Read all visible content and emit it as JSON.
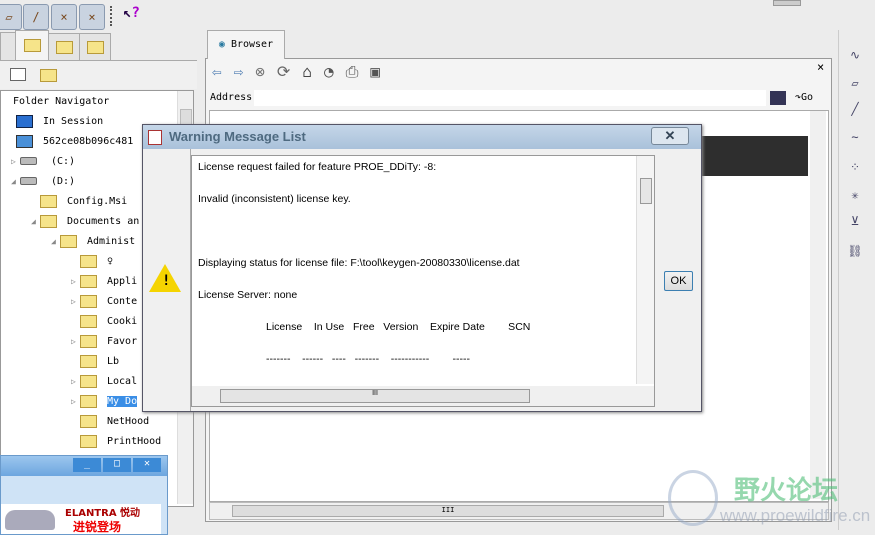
{
  "toolbar": {
    "icons": [
      "plane-eye-icon",
      "axis-eye-icon",
      "point-eye-icon",
      "csys-eye-icon"
    ],
    "help_icon": "context-help-icon"
  },
  "left_panel": {
    "tabs": [
      "model-tree-icon",
      "folder-browser-icon",
      "favorites-icon",
      "connections-icon"
    ],
    "tree": {
      "header": "Folder Navigator",
      "items": [
        {
          "label": "In Session",
          "icon": "session",
          "indent": 0
        },
        {
          "label": "562ce08b096c481",
          "icon": "computer",
          "indent": 0
        },
        {
          "label": "(C:)",
          "icon": "drive",
          "indent": 1,
          "exp": "closed"
        },
        {
          "label": "(D:)",
          "icon": "drive",
          "indent": 1,
          "exp": "open"
        },
        {
          "label": "Config.Msi",
          "icon": "folder",
          "indent": 2
        },
        {
          "label": "Documents an",
          "icon": "folder",
          "indent": 2,
          "exp": "open"
        },
        {
          "label": "Administ",
          "icon": "folder",
          "indent": 3,
          "exp": "open"
        },
        {
          "label": "♀",
          "icon": "folder",
          "indent": 4
        },
        {
          "label": "Appli",
          "icon": "folder",
          "indent": 4,
          "exp": "closed"
        },
        {
          "label": "Conte",
          "icon": "folder",
          "indent": 4,
          "exp": "closed"
        },
        {
          "label": "Cooki",
          "icon": "folder",
          "indent": 4
        },
        {
          "label": "Favor",
          "icon": "folder",
          "indent": 4,
          "exp": "closed"
        },
        {
          "label": "Lb",
          "icon": "folder",
          "indent": 4
        },
        {
          "label": "Local",
          "icon": "folder",
          "indent": 4,
          "exp": "closed"
        },
        {
          "label": "My Do",
          "icon": "folder",
          "indent": 4,
          "exp": "closed",
          "selected": true
        },
        {
          "label": "NetHood",
          "icon": "folder",
          "indent": 4
        },
        {
          "label": "PrintHood",
          "icon": "folder",
          "indent": 4
        }
      ]
    }
  },
  "browser": {
    "tab": "Browser",
    "address_label": "Address",
    "go": "Go"
  },
  "dialog": {
    "title": "Warning Message List",
    "lines": [
      "License request failed for feature PROE_DDiTy: -8:",
      "Invalid (inconsistent) license key.",
      "Displaying status for license file: F:\\tool\\keygen-20080330\\license.dat",
      "License Server: none",
      "License    In Use   Free   Version    Expire Date        SCN",
      "-------    ------   ----   -------    -----------        -----"
    ],
    "ok": "OK"
  },
  "mini_window": {
    "ad_text_1": "ELANTRA 悦动",
    "ad_text_2": "进锐登场"
  },
  "watermark": {
    "name": "野火论坛",
    "url": "www.proewildfire.cn"
  }
}
